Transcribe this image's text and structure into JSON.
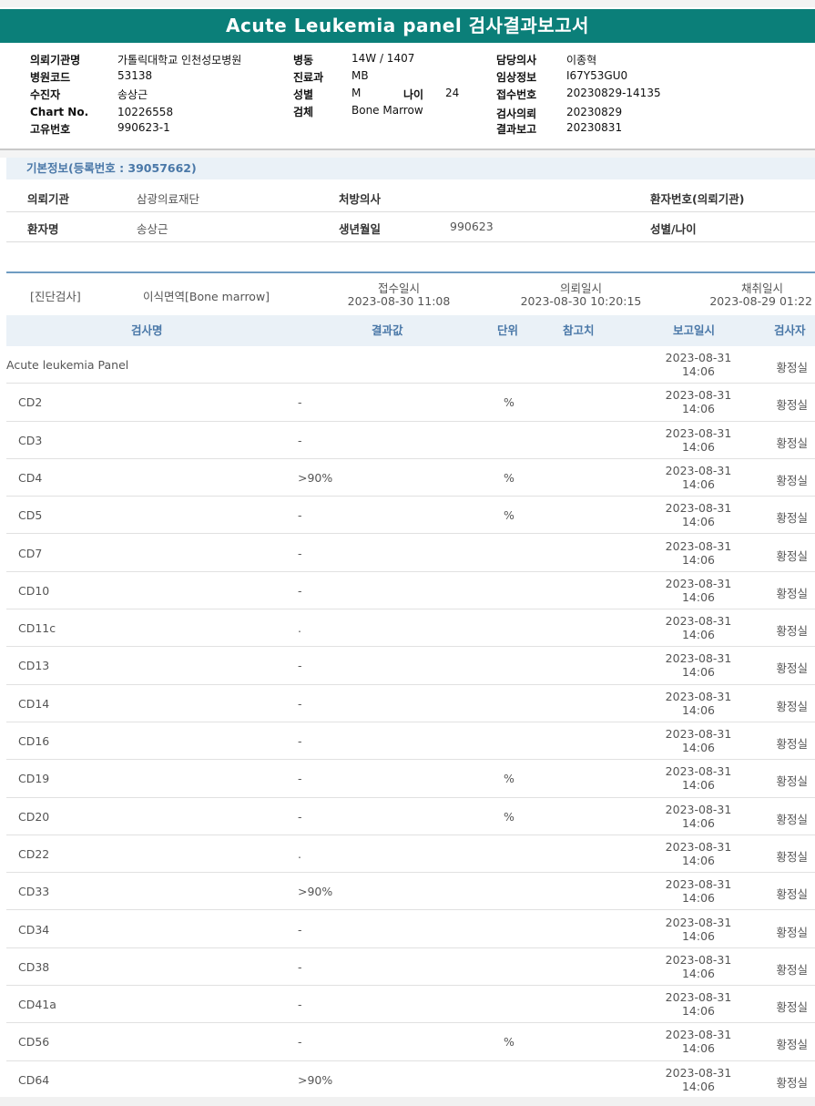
{
  "title": "Acute Leukemia panel 검사결과보고서",
  "header": {
    "col1": [
      {
        "label": "의뢰기관명",
        "value": "가톨릭대학교 인천성모병원"
      },
      {
        "label": "병원코드",
        "value": "53138"
      },
      {
        "label": "수진자",
        "value": "송상근"
      },
      {
        "label": "Chart No.",
        "value": "10226558"
      },
      {
        "label": "고유번호",
        "value": "990623-1"
      }
    ],
    "col2": [
      {
        "label": "병동",
        "value": "14W / 1407"
      },
      {
        "label": "진료과",
        "value": "MB"
      },
      {
        "label": "성별",
        "value": "M"
      },
      {
        "label": "검체",
        "value": "Bone Marrow"
      }
    ],
    "age_label": "나이",
    "age_value": "24",
    "col3": [
      {
        "label": "담당의사",
        "value": "이종혁"
      },
      {
        "label": "임상정보",
        "value": "I67Y53GU0"
      },
      {
        "label": "접수번호",
        "value": "20230829-14135"
      },
      {
        "label": "검사의뢰",
        "value": "20230829"
      },
      {
        "label": "결과보고",
        "value": "20230831"
      }
    ]
  },
  "basic_info": {
    "title": "기본정보(등록번호 : 39057662)",
    "institution_label": "의뢰기관",
    "institution_value": "삼광의료재단",
    "doctor_label": "처방의사",
    "patient_no_label": "환자번호(의뢰기관)",
    "patient_label": "환자명",
    "patient_value": "송상근",
    "birth_label": "생년월일",
    "birth_value": "990623",
    "sex_age_label": "성별/나이"
  },
  "exam_meta": {
    "category": "[진단검사]",
    "department": "이식면역[Bone marrow]",
    "received_label": "접수일시",
    "received_value": "2023-08-30 11:08",
    "requested_label": "의뢰일시",
    "requested_value": "2023-08-30 10:20:15",
    "collected_label": "채취일시",
    "collected_value": "2023-08-29 01:22"
  },
  "table": {
    "headers": {
      "name": "검사명",
      "result": "결과값",
      "unit": "단위",
      "reference": "참고치",
      "report_date": "보고일시",
      "tester": "검사자"
    },
    "rows": [
      {
        "name": "Acute leukemia Panel",
        "result": "",
        "unit": "",
        "date": "2023-08-31",
        "time": "14:06",
        "tester": "황정실",
        "panel": true
      },
      {
        "name": "CD2",
        "result": "-",
        "unit": "%",
        "date": "2023-08-31",
        "time": "14:06",
        "tester": "황정실"
      },
      {
        "name": "CD3",
        "result": "-",
        "unit": "",
        "date": "2023-08-31",
        "time": "14:06",
        "tester": "황정실"
      },
      {
        "name": "CD4",
        "result": ">90%",
        "unit": "%",
        "date": "2023-08-31",
        "time": "14:06",
        "tester": "황정실"
      },
      {
        "name": "CD5",
        "result": "-",
        "unit": "%",
        "date": "2023-08-31",
        "time": "14:06",
        "tester": "황정실"
      },
      {
        "name": "CD7",
        "result": "-",
        "unit": "",
        "date": "2023-08-31",
        "time": "14:06",
        "tester": "황정실"
      },
      {
        "name": "CD10",
        "result": "-",
        "unit": "",
        "date": "2023-08-31",
        "time": "14:06",
        "tester": "황정실"
      },
      {
        "name": "CD11c",
        "result": ".",
        "unit": "",
        "date": "2023-08-31",
        "time": "14:06",
        "tester": "황정실"
      },
      {
        "name": "CD13",
        "result": "-",
        "unit": "",
        "date": "2023-08-31",
        "time": "14:06",
        "tester": "황정실"
      },
      {
        "name": "CD14",
        "result": "-",
        "unit": "",
        "date": "2023-08-31",
        "time": "14:06",
        "tester": "황정실"
      },
      {
        "name": "CD16",
        "result": "-",
        "unit": "",
        "date": "2023-08-31",
        "time": "14:06",
        "tester": "황정실"
      },
      {
        "name": "CD19",
        "result": "-",
        "unit": "%",
        "date": "2023-08-31",
        "time": "14:06",
        "tester": "황정실"
      },
      {
        "name": "CD20",
        "result": "-",
        "unit": "%",
        "date": "2023-08-31",
        "time": "14:06",
        "tester": "황정실"
      },
      {
        "name": "CD22",
        "result": ".",
        "unit": "",
        "date": "2023-08-31",
        "time": "14:06",
        "tester": "황정실"
      },
      {
        "name": "CD33",
        "result": ">90%",
        "unit": "",
        "date": "2023-08-31",
        "time": "14:06",
        "tester": "황정실"
      },
      {
        "name": "CD34",
        "result": "-",
        "unit": "",
        "date": "2023-08-31",
        "time": "14:06",
        "tester": "황정실"
      },
      {
        "name": "CD38",
        "result": "-",
        "unit": "",
        "date": "2023-08-31",
        "time": "14:06",
        "tester": "황정실"
      },
      {
        "name": "CD41a",
        "result": "-",
        "unit": "",
        "date": "2023-08-31",
        "time": "14:06",
        "tester": "황정실"
      },
      {
        "name": "CD56",
        "result": "-",
        "unit": "%",
        "date": "2023-08-31",
        "time": "14:06",
        "tester": "황정실"
      },
      {
        "name": "CD64",
        "result": ">90%",
        "unit": "",
        "date": "2023-08-31",
        "time": "14:06",
        "tester": "황정실"
      }
    ]
  }
}
